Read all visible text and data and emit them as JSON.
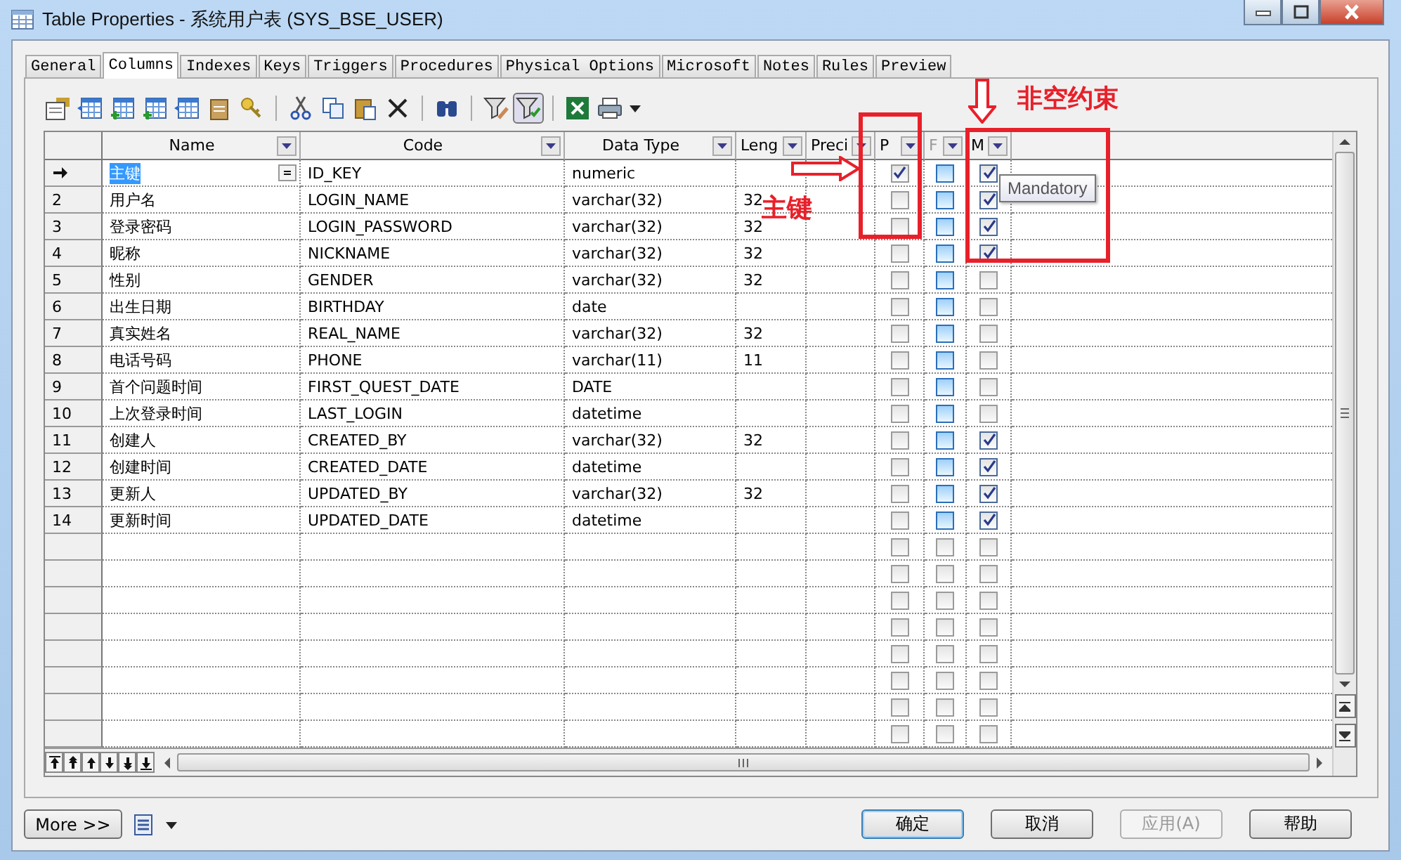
{
  "window": {
    "title": "Table Properties - 系统用户表 (SYS_BSE_USER)"
  },
  "tabs": [
    {
      "label": "General",
      "selected": false
    },
    {
      "label": "Columns",
      "selected": true
    },
    {
      "label": "Indexes",
      "selected": false
    },
    {
      "label": "Keys",
      "selected": false
    },
    {
      "label": "Triggers",
      "selected": false
    },
    {
      "label": "Procedures",
      "selected": false
    },
    {
      "label": "Physical Options",
      "selected": false
    },
    {
      "label": "Microsoft",
      "selected": false
    },
    {
      "label": "Notes",
      "selected": false
    },
    {
      "label": "Rules",
      "selected": false
    },
    {
      "label": "Preview",
      "selected": false
    }
  ],
  "table": {
    "columns": [
      {
        "label": "Name",
        "disabled": false
      },
      {
        "label": "Code",
        "disabled": false
      },
      {
        "label": "Data Type",
        "disabled": false
      },
      {
        "label": "Leng",
        "disabled": false
      },
      {
        "label": "Preci",
        "disabled": false
      },
      {
        "label": "P",
        "disabled": false
      },
      {
        "label": "F",
        "disabled": true
      },
      {
        "label": "M",
        "disabled": false
      }
    ],
    "rows": [
      {
        "kind": "data",
        "selected": true,
        "name": "主键",
        "code": "ID_KEY",
        "data_type": "numeric",
        "length": "",
        "primary": true,
        "foreign": false,
        "mandatory": true
      },
      {
        "kind": "data",
        "number": "2",
        "selected": false,
        "name": "用户名",
        "code": "LOGIN_NAME",
        "data_type": "varchar(32)",
        "length": "32",
        "primary": false,
        "foreign": false,
        "mandatory": true
      },
      {
        "kind": "data",
        "number": "3",
        "selected": false,
        "name": "登录密码",
        "code": "LOGIN_PASSWORD",
        "data_type": "varchar(32)",
        "length": "32",
        "primary": false,
        "foreign": false,
        "mandatory": true
      },
      {
        "kind": "data",
        "number": "4",
        "selected": false,
        "name": "昵称",
        "code": "NICKNAME",
        "data_type": "varchar(32)",
        "length": "32",
        "primary": false,
        "foreign": false,
        "mandatory": true
      },
      {
        "kind": "data",
        "number": "5",
        "selected": false,
        "name": "性别",
        "code": "GENDER",
        "data_type": "varchar(32)",
        "length": "32",
        "primary": false,
        "foreign": false,
        "mandatory": false
      },
      {
        "kind": "data",
        "number": "6",
        "selected": false,
        "name": "出生日期",
        "code": "BIRTHDAY",
        "data_type": "date",
        "length": "",
        "primary": false,
        "foreign": false,
        "mandatory": false
      },
      {
        "kind": "data",
        "number": "7",
        "selected": false,
        "name": "真实姓名",
        "code": "REAL_NAME",
        "data_type": "varchar(32)",
        "length": "32",
        "primary": false,
        "foreign": false,
        "mandatory": false
      },
      {
        "kind": "data",
        "number": "8",
        "selected": false,
        "name": "电话号码",
        "code": "PHONE",
        "data_type": "varchar(11)",
        "length": "11",
        "primary": false,
        "foreign": false,
        "mandatory": false
      },
      {
        "kind": "data",
        "number": "9",
        "selected": false,
        "name": "首个问题时间",
        "code": "FIRST_QUEST_DATE",
        "data_type": "DATE",
        "length": "",
        "primary": false,
        "foreign": false,
        "mandatory": false
      },
      {
        "kind": "data",
        "number": "10",
        "selected": false,
        "name": "上次登录时间",
        "code": "LAST_LOGIN",
        "data_type": "datetime",
        "length": "",
        "primary": false,
        "foreign": false,
        "mandatory": false
      },
      {
        "kind": "data",
        "number": "11",
        "selected": false,
        "name": "创建人",
        "code": "CREATED_BY",
        "data_type": "varchar(32)",
        "length": "32",
        "primary": false,
        "foreign": false,
        "mandatory": true
      },
      {
        "kind": "data",
        "number": "12",
        "selected": false,
        "name": "创建时间",
        "code": "CREATED_DATE",
        "data_type": "datetime",
        "length": "",
        "primary": false,
        "foreign": false,
        "mandatory": true
      },
      {
        "kind": "data",
        "number": "13",
        "selected": false,
        "name": "更新人",
        "code": "UPDATED_BY",
        "data_type": "varchar(32)",
        "length": "32",
        "primary": false,
        "foreign": false,
        "mandatory": true
      },
      {
        "kind": "data",
        "number": "14",
        "selected": false,
        "name": "更新时间",
        "code": "UPDATED_DATE",
        "data_type": "datetime",
        "length": "",
        "primary": false,
        "foreign": false,
        "mandatory": true
      },
      {
        "kind": "blank",
        "selected": false,
        "primary": false,
        "foreign": false,
        "mandatory": false
      },
      {
        "kind": "blank",
        "selected": false,
        "primary": false,
        "foreign": false,
        "mandatory": false
      },
      {
        "kind": "blank",
        "selected": false,
        "primary": false,
        "foreign": false,
        "mandatory": false
      },
      {
        "kind": "blank",
        "selected": false,
        "primary": false,
        "foreign": false,
        "mandatory": false
      },
      {
        "kind": "blank",
        "selected": false,
        "primary": false,
        "foreign": false,
        "mandatory": false
      },
      {
        "kind": "blank",
        "selected": false,
        "primary": false,
        "foreign": false,
        "mandatory": false
      },
      {
        "kind": "blank",
        "selected": false,
        "primary": false,
        "foreign": false,
        "mandatory": false
      },
      {
        "kind": "blank",
        "selected": false,
        "primary": false,
        "foreign": false,
        "mandatory": false
      }
    ]
  },
  "tooltip": "Mandatory",
  "annotations": [
    {
      "kind": "label",
      "text": "非空约束"
    },
    {
      "kind": "label",
      "text": "主键"
    },
    {
      "kind": "arrow_down"
    },
    {
      "kind": "arrow_right"
    },
    {
      "kind": "box"
    },
    {
      "kind": "box"
    }
  ],
  "buttons": [
    {
      "label": "More >>",
      "kind": "more",
      "disabled": false
    },
    {
      "label": "确定",
      "kind": "default",
      "disabled": false
    },
    {
      "label": "取消",
      "kind": "normal",
      "disabled": false
    },
    {
      "label": "应用(A)",
      "kind": "normal",
      "disabled": true
    },
    {
      "label": "帮助",
      "kind": "normal",
      "disabled": false
    }
  ]
}
